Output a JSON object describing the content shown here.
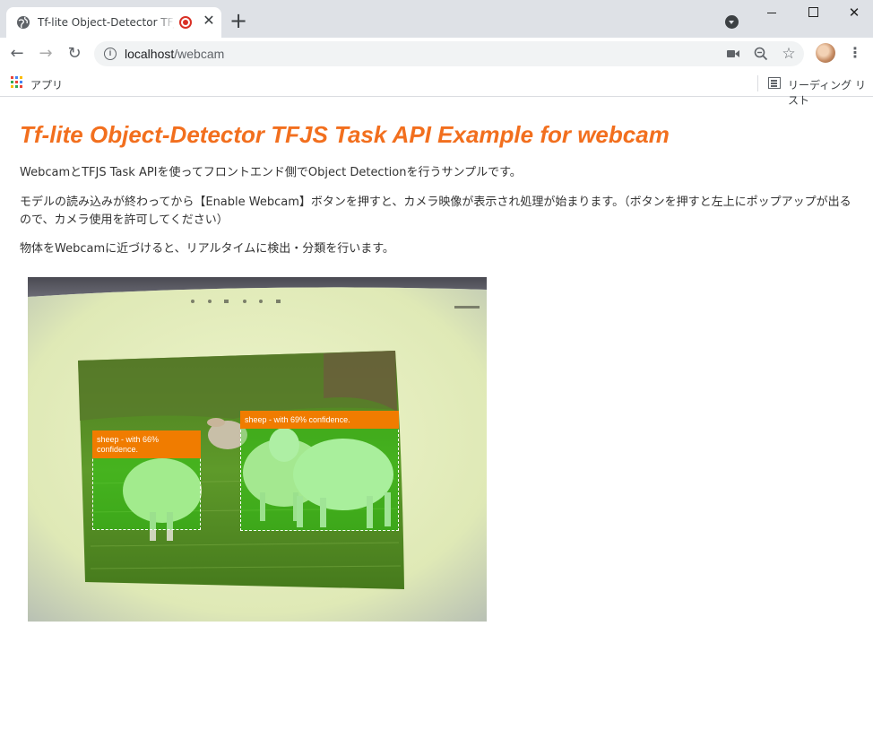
{
  "browser": {
    "tab_title": "Tf-lite Object-Detector TFJS Task API Example for webcam",
    "new_tab": "+",
    "url_host": "localhost",
    "url_path": "/webcam",
    "bookmarks_apps": "アプリ",
    "reading_list": "リーディング リスト"
  },
  "page": {
    "title": "Tf-lite Object-Detector TFJS Task API Example for webcam",
    "paragraphs": [
      "WebcamとTFJS Task APIを使ってフロントエンド側でObject Detectionを行うサンプルです。",
      "モデルの読み込みが終わってから【Enable Webcam】ボタンを押すと、カメラ映像が表示され処理が始まります。（ボタンを押すと左上にポップアップが出るので、カメラ使用を許可してください）",
      "物体をWebcamに近づけると、リアルタイムに検出・分類を行います。"
    ]
  },
  "detections": [
    {
      "label": "sheep - with 66% confidence."
    },
    {
      "label": "sheep - with 69% confidence."
    }
  ],
  "colors": {
    "accent": "#f26f1e",
    "label_bg": "#f07c00",
    "highlight": "#00ff00"
  },
  "icons": [
    "globe-icon",
    "record-icon",
    "close-icon",
    "plus-icon",
    "tab-search-icon",
    "back-icon",
    "forward-icon",
    "reload-icon",
    "info-icon",
    "camera-icon",
    "zoom-icon",
    "star-icon",
    "avatar",
    "menu-icon",
    "apps-icon",
    "reading-list-icon"
  ]
}
